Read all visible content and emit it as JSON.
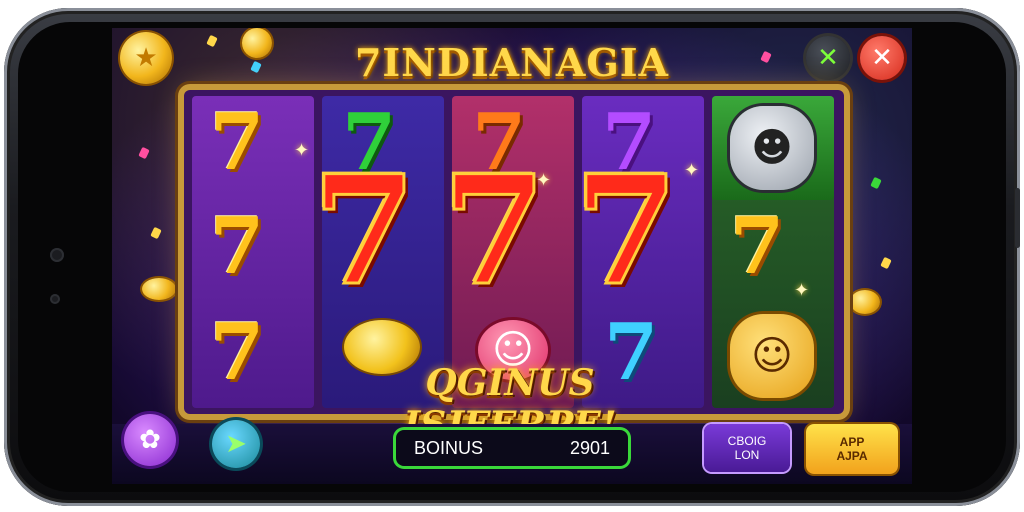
{
  "game": {
    "title": "7INDIANAGIA",
    "banner": "QGINUS ISJFERPE!",
    "bonus_label": "BOINUS",
    "bonus_value": "2901",
    "btn_left_line1": "CBOIG",
    "btn_left_line2": "LON",
    "btn_right_line1": "APP",
    "btn_right_line2": "AJPA",
    "close_glyph": "✕",
    "check_glyph": "✕"
  },
  "reels": [
    {
      "symbols": [
        "7",
        "7",
        "7"
      ],
      "color": "#ffc21c"
    },
    {
      "symbols": [
        "7",
        "7"
      ],
      "color": "#2fd13a"
    },
    {
      "symbols": [
        "7",
        "7"
      ],
      "color": "#ff7a1a"
    },
    {
      "symbols": [
        "7",
        "7",
        "7"
      ],
      "color": "#b34cff"
    },
    {
      "symbols": [
        "7"
      ],
      "color": "#ffc21c"
    }
  ],
  "feature": {
    "symbol": "7",
    "color": "#ff2a1a"
  },
  "icons": {
    "coin": "coin-icon",
    "menu": "menu-icon",
    "play": "play-icon",
    "close": "close-icon",
    "check": "check-icon"
  },
  "colors": {
    "gold": "#ffd84a",
    "accent_green": "#3ad83a",
    "accent_purple": "#7a3ad8"
  }
}
